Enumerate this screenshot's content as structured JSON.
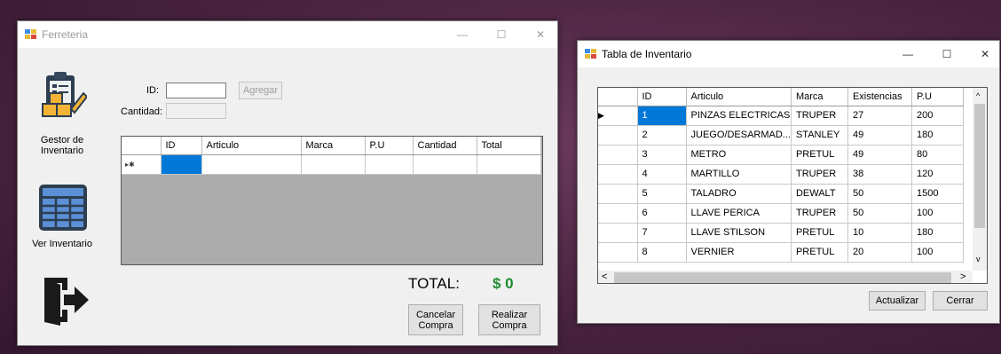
{
  "main_window": {
    "title": "Ferreteria",
    "controls": {
      "minimize": "—",
      "maximize": "☐",
      "close": "✕"
    },
    "sidebar": {
      "inventory_manager_label": "Gestor de Inventario",
      "view_inventory_label": "Ver Inventario"
    },
    "form": {
      "id_label": "ID:",
      "id_value": "",
      "add_button": "Agregar",
      "quantity_label": "Cantidad:",
      "quantity_value": ""
    },
    "cart_grid": {
      "headers": [
        "ID",
        "Articulo",
        "Marca",
        "P.U",
        "Cantidad",
        "Total"
      ],
      "new_row_marker": "▸✱"
    },
    "total_label": "TOTAL:",
    "total_value": "$ 0",
    "cancel_button": "Cancelar Compra",
    "checkout_button": "Realizar Compra"
  },
  "inventory_window": {
    "title": "Tabla de Inventario",
    "controls": {
      "minimize": "—",
      "maximize": "☐",
      "close": "✕"
    },
    "grid": {
      "headers": [
        "ID",
        "Articulo",
        "Marca",
        "Existencias",
        "P.U"
      ],
      "current_row_marker": "▶",
      "rows": [
        [
          "1",
          "PINZAS ELECTRICAS",
          "TRUPER",
          "27",
          "200"
        ],
        [
          "2",
          "JUEGO/DESARMAD...",
          "STANLEY",
          "49",
          "180"
        ],
        [
          "3",
          "METRO",
          "PRETUL",
          "49",
          "80"
        ],
        [
          "4",
          "MARTILLO",
          "TRUPER",
          "38",
          "120"
        ],
        [
          "5",
          "TALADRO",
          "DEWALT",
          "50",
          "1500"
        ],
        [
          "6",
          "LLAVE PERICA",
          "TRUPER",
          "50",
          "100"
        ],
        [
          "7",
          "LLAVE STILSON",
          "PRETUL",
          "10",
          "180"
        ],
        [
          "8",
          "VERNIER",
          "PRETUL",
          "20",
          "100"
        ]
      ]
    },
    "refresh_button": "Actualizar",
    "close_button": "Cerrar"
  },
  "colors": {
    "total_green": "#1e8c2e",
    "selection_blue": "#0078d7"
  }
}
